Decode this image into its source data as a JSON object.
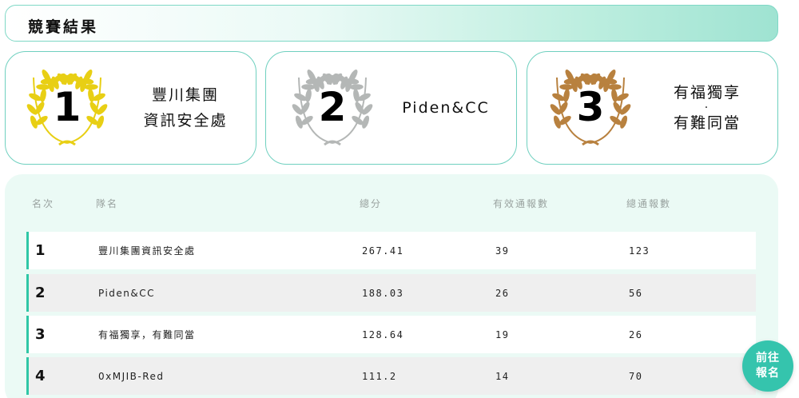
{
  "header": {
    "title": "競賽結果"
  },
  "podium": [
    {
      "rank": "1",
      "name_lines": [
        "豐川集團",
        "資訊安全處"
      ],
      "wreath_color": "#e8cf14",
      "wreath_icon": "laurel-wreath-gold-icon"
    },
    {
      "rank": "2",
      "name_lines": [
        "Piden&CC"
      ],
      "wreath_color": "#b4b7b6",
      "wreath_icon": "laurel-wreath-silver-icon"
    },
    {
      "rank": "3",
      "name_lines": [
        "有福獨享",
        "·",
        "有難同當"
      ],
      "wreath_color": "#b8813f",
      "wreath_icon": "laurel-wreath-bronze-icon"
    }
  ],
  "table": {
    "headers": {
      "rank": "名次",
      "team": "隊名",
      "score": "總分",
      "valid": "有效通報數",
      "total": "總通報數"
    },
    "rows": [
      {
        "rank": "1",
        "team": "豐川集團資訊安全處",
        "score": "267.41",
        "valid": "39",
        "total": "123"
      },
      {
        "rank": "2",
        "team": "Piden&CC",
        "score": "188.03",
        "valid": "26",
        "total": "56"
      },
      {
        "rank": "3",
        "team": "有福獨享，有難同當",
        "score": "128.64",
        "valid": "19",
        "total": "26"
      },
      {
        "rank": "4",
        "team": "0xMJIB-Red",
        "score": "111.2",
        "valid": "14",
        "total": "70"
      }
    ]
  },
  "fab": {
    "line1": "前往",
    "line2": "報名"
  },
  "colors": {
    "accent": "#35c4ad",
    "border": "#6fd0bf",
    "board_bg": "#ebfaf5"
  }
}
